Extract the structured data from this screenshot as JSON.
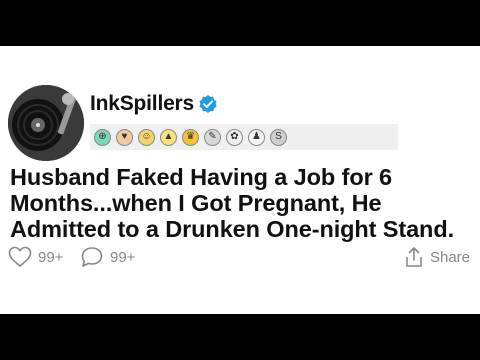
{
  "post": {
    "author": "InkSpillers",
    "headline": "Husband Faked Having a Job for 6 Months...when I Got Pregnant, He Admitted to a Drunken One-night Stand.",
    "likes": "99+",
    "comments": "99+",
    "share_label": "Share"
  },
  "icons": {
    "verified": "verified-badge-icon",
    "like": "heart-icon",
    "comment": "comment-bubble-icon",
    "share": "share-icon"
  },
  "awards": [
    {
      "name": "award-1",
      "glyph": "⊕"
    },
    {
      "name": "award-2",
      "glyph": "♥"
    },
    {
      "name": "award-3",
      "glyph": "☺"
    },
    {
      "name": "award-4",
      "glyph": "▲"
    },
    {
      "name": "award-5",
      "glyph": "♛"
    },
    {
      "name": "award-6",
      "glyph": "✎"
    },
    {
      "name": "award-7",
      "glyph": "✿"
    },
    {
      "name": "award-8",
      "glyph": "♟"
    },
    {
      "name": "award-9",
      "glyph": "S"
    }
  ],
  "colors": {
    "verified_blue": "#1d9bf0",
    "icon_gray": "#888888"
  }
}
